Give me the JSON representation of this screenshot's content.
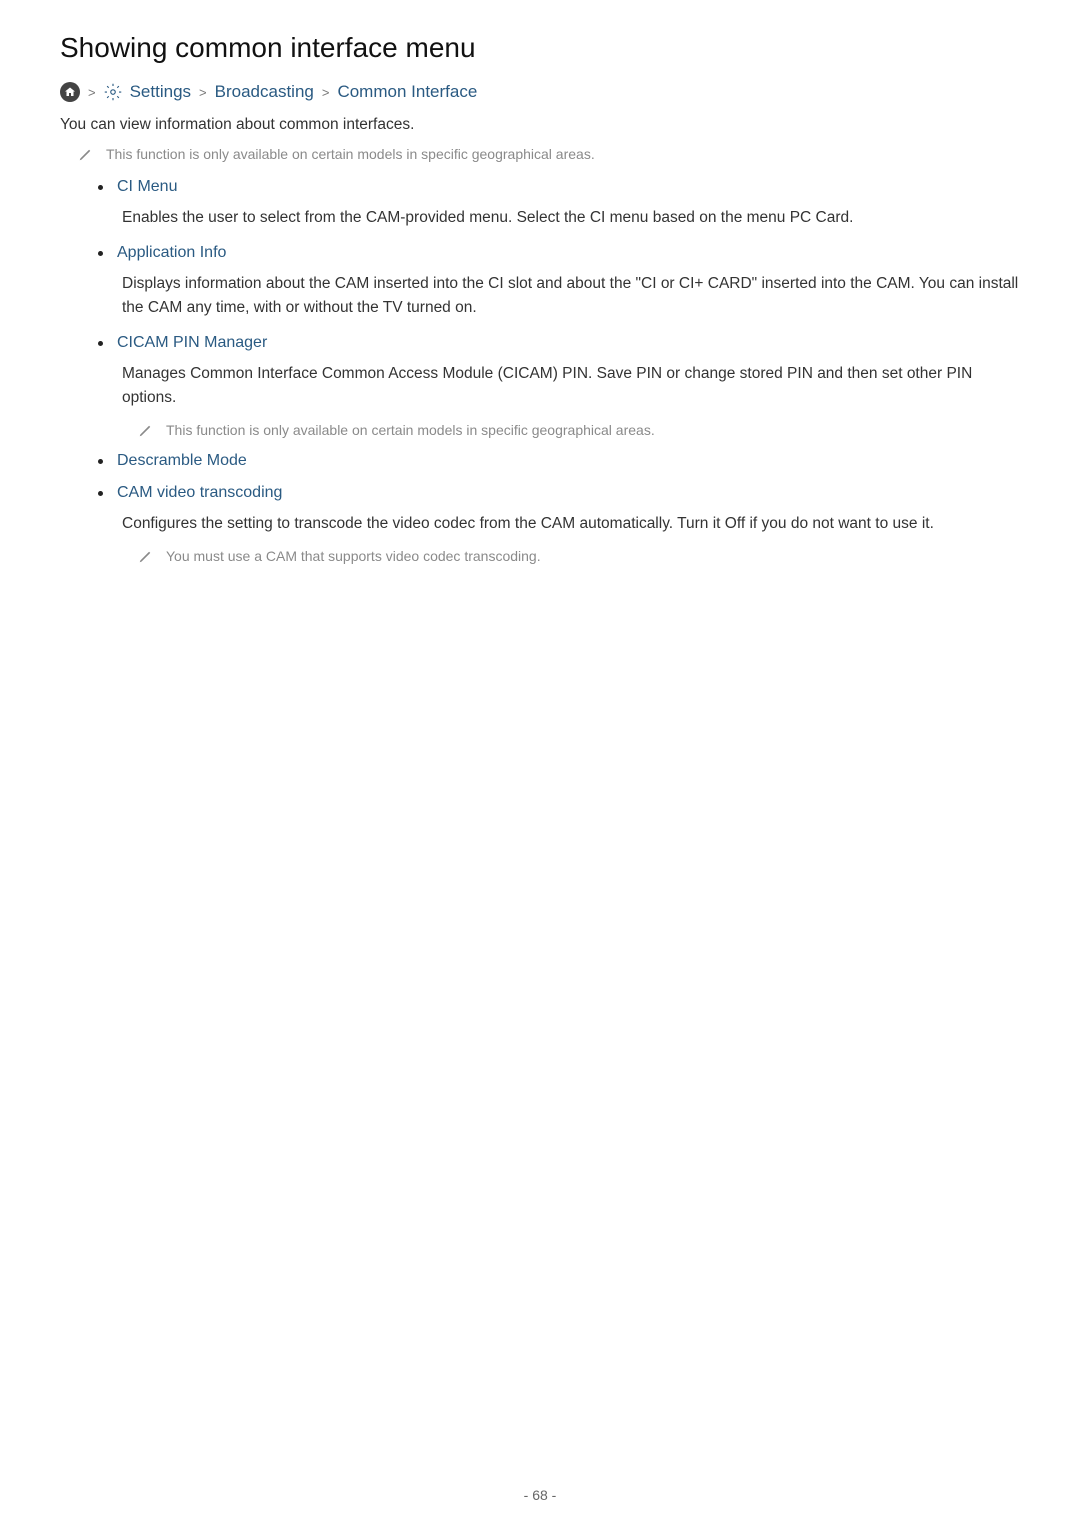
{
  "heading": "Showing common interface menu",
  "breadcrumb": {
    "settings": "Settings",
    "broadcasting": "Broadcasting",
    "common_interface": "Common Interface"
  },
  "intro": "You can view information about common interfaces.",
  "note1": "This function is only available on certain models in specific geographical areas.",
  "items": {
    "ci_menu": {
      "title": "CI Menu",
      "desc": "Enables the user to select from the CAM-provided menu. Select the CI menu based on the menu PC Card."
    },
    "app_info": {
      "title": "Application Info",
      "desc": "Displays information about the CAM inserted into the CI slot and about the \"CI or CI+ CARD\" inserted into the CAM. You can install the CAM any time, with or without the TV turned on."
    },
    "cicam": {
      "title": "CICAM PIN Manager",
      "desc": "Manages Common Interface Common Access Module (CICAM) PIN. Save PIN or change stored PIN and then set other PIN options.",
      "note": "This function is only available on certain models in specific geographical areas."
    },
    "descramble": {
      "title": "Descramble Mode"
    },
    "cam_video": {
      "title": "CAM video transcoding",
      "desc": "Configures the setting to transcode the video codec from the CAM automatically. Turn it Off if you do not want to use it.",
      "note": "You must use a CAM that supports video codec transcoding."
    }
  },
  "page_number": "- 68 -"
}
